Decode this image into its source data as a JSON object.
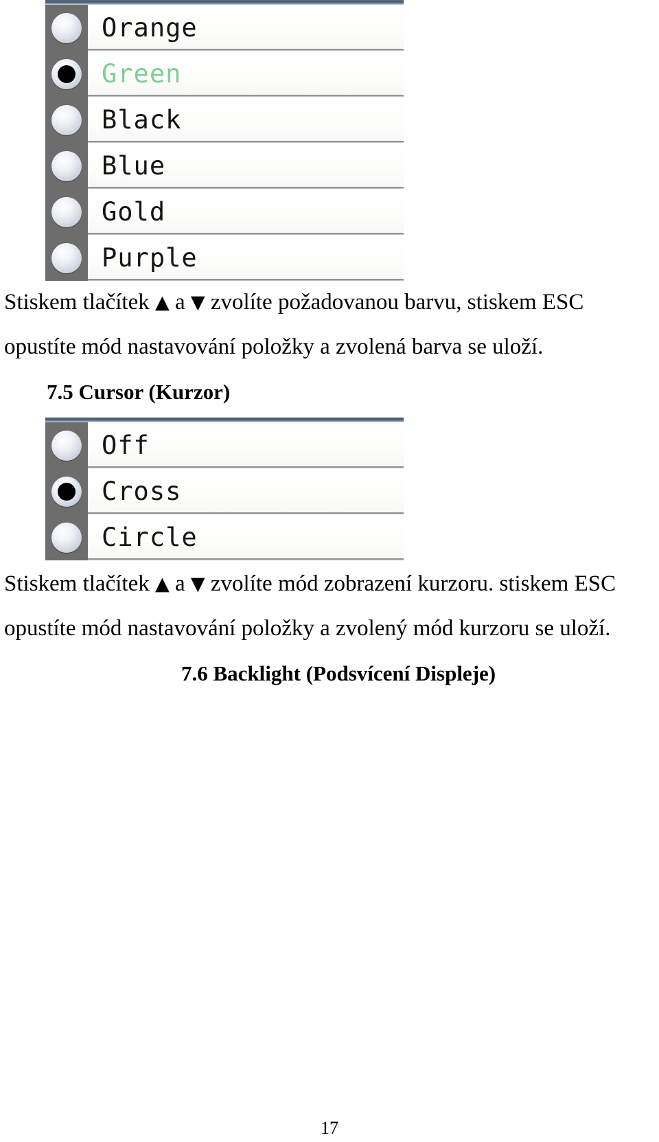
{
  "page": {
    "number": "17",
    "language": "cs"
  },
  "color_menu": {
    "name": "color-selection-screen",
    "options": [
      {
        "label": "Orange",
        "selected": false,
        "text_color": "#141414"
      },
      {
        "label": "Green",
        "selected": true,
        "text_color": "#7fcf93"
      },
      {
        "label": "Black",
        "selected": false,
        "text_color": "#141414"
      },
      {
        "label": "Blue",
        "selected": false,
        "text_color": "#141414"
      },
      {
        "label": "Gold",
        "selected": false,
        "text_color": "#141414"
      },
      {
        "label": "Purple",
        "selected": false,
        "text_color": "#141414"
      }
    ]
  },
  "color_instructions": {
    "line1_a": "Stiskem tlačítek",
    "line1_up": "▲",
    "line1_mid": "a",
    "line1_down": "▼",
    "line1_b": "zvolíte požadovanou barvu, stiskem ESC",
    "line2": "opustíte mód nastavování položky a zvolená barva se uloží."
  },
  "section_75": {
    "number": "7.5",
    "title": "Cursor (Kurzor)",
    "full": "7.5 Cursor (Kurzor)"
  },
  "cursor_menu": {
    "name": "cursor-selection-screen",
    "options": [
      {
        "label": "Off",
        "selected": false,
        "text_color": "#141414"
      },
      {
        "label": "Cross",
        "selected": true,
        "text_color": "#141414"
      },
      {
        "label": "Circle",
        "selected": false,
        "text_color": "#141414"
      }
    ]
  },
  "cursor_instructions": {
    "line1_a": "Stiskem tlačítek",
    "line1_up": "▲",
    "line1_mid": "a",
    "line1_down": "▼",
    "line1_b": "zvolíte mód zobrazení kurzoru. stiskem ESC",
    "line2": "opustíte mód nastavování položky a zvolený mód kurzoru se uloží."
  },
  "section_76": {
    "number": "7.6",
    "title": "Backlight (Podsvícení Displeje)",
    "full": "7.6 Backlight (Podsvícení Displeje)"
  },
  "colors": {
    "topbar": "#46586e",
    "radio_cell_bg": "#6d6d6d",
    "row_divider": "#8e8e8e",
    "selected_green": "#7fcf93",
    "text": "#000000"
  }
}
